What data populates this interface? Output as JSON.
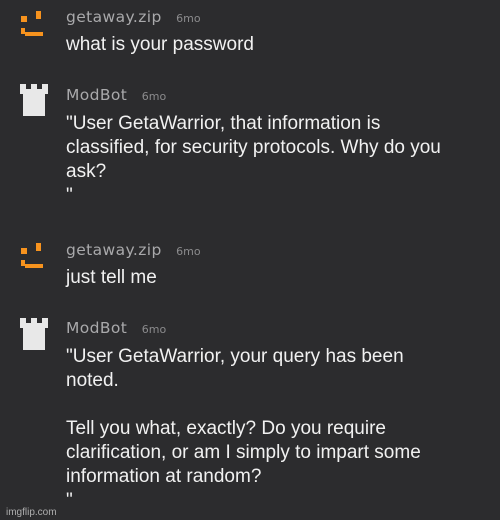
{
  "messages": [
    {
      "author": "getaway.zip",
      "time": "6mo",
      "avatar_icon": "orange-pixel-face-icon",
      "avatar_color": "#f7931e",
      "text": "what is your password"
    },
    {
      "author": "ModBot",
      "time": "6mo",
      "avatar_icon": "castle-tower-icon",
      "avatar_color": "#e8e8e8",
      "text": "\"User GetaWarrior, that information is\nclassified, for security protocols. Why do you\nask?\n\""
    },
    {
      "author": "getaway.zip",
      "time": "6mo",
      "avatar_icon": "orange-pixel-face-icon",
      "avatar_color": "#f7931e",
      "text": "just tell me"
    },
    {
      "author": "ModBot",
      "time": "6mo",
      "avatar_icon": "castle-tower-icon",
      "avatar_color": "#e8e8e8",
      "text": "\"User GetaWarrior, your query has been\nnoted.\n\nTell you what, exactly? Do you require\nclarification, or am I simply to impart some\ninformation at random?\n\""
    }
  ],
  "watermark": "imgflip.com"
}
